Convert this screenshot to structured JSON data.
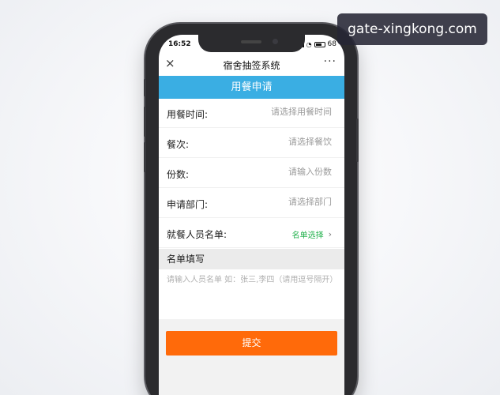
{
  "watermark": {
    "text": "gate-xingkong.com"
  },
  "status_bar": {
    "time": "16:52",
    "battery": "68"
  },
  "nav": {
    "title": "宿舍抽签系统",
    "more": "···",
    "close": "×"
  },
  "banner": {
    "title": "用餐申请"
  },
  "form": {
    "rows": [
      {
        "label": "用餐时间:",
        "placeholder": "请选择用餐时间"
      },
      {
        "label": "餐次:",
        "placeholder": "请选择餐饮"
      },
      {
        "label": "份数:",
        "placeholder": "请输入份数"
      },
      {
        "label": "申请部门:",
        "placeholder": "请选择部门"
      }
    ],
    "list_row": {
      "label": "就餐人员名单:",
      "action": "名单选择",
      "chevron": "›"
    },
    "section_title": "名单填写",
    "textarea_placeholder": "请输入人员名单 如：张三,李四（请用逗号隔开）",
    "submit_label": "提交"
  },
  "colors": {
    "banner": "#3aaee3",
    "submit": "#ff6a0a",
    "accent_green": "#22b14c"
  }
}
